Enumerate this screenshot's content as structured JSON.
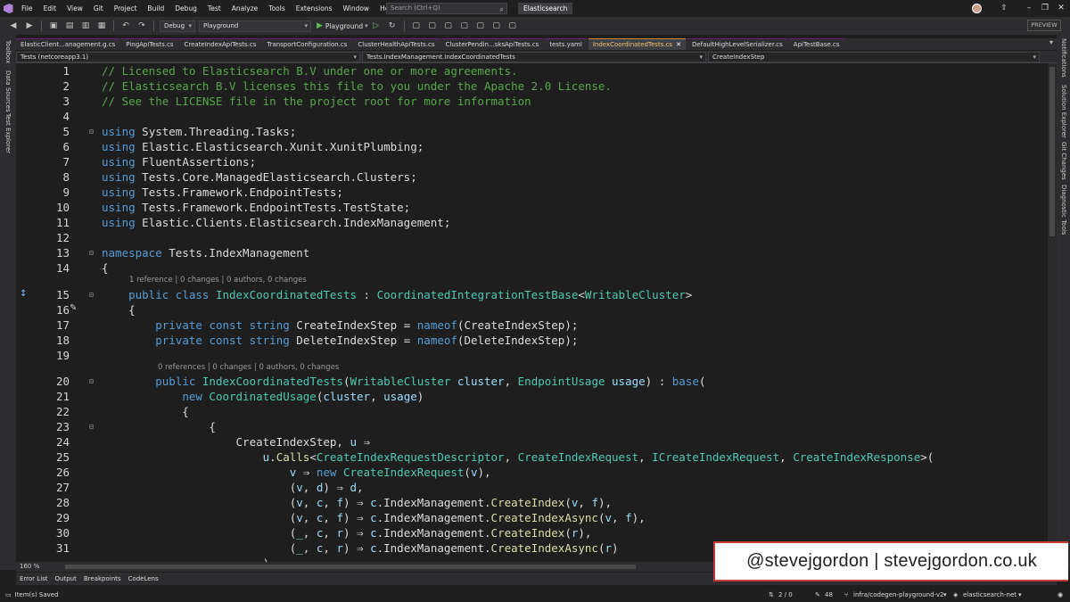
{
  "menu": {
    "items": [
      "File",
      "Edit",
      "View",
      "Git",
      "Project",
      "Build",
      "Debug",
      "Test",
      "Analyze",
      "Tools",
      "Extensions",
      "Window",
      "Help"
    ],
    "search_placeholder": "Search (Ctrl+Q)",
    "solution_name": "Elasticsearch"
  },
  "toolbar": {
    "config": "Debug",
    "project": "Playground",
    "run_target": "Playground",
    "preview_label": "PREVIEW"
  },
  "left_rail": [
    "Toolbox",
    "Data Sources",
    "Test Explorer"
  ],
  "right_rail": [
    "Notifications",
    "Solution Explorer",
    "Git Changes",
    "Diagnostic Tools"
  ],
  "tabs": [
    {
      "label": "ElasticClient...anagement.g.cs",
      "active": false
    },
    {
      "label": "PingApiTests.cs",
      "active": false
    },
    {
      "label": "CreateIndexApiTests.cs",
      "active": false
    },
    {
      "label": "TransportConfiguration.cs",
      "active": false
    },
    {
      "label": "ClusterHealthApiTests.cs",
      "active": false
    },
    {
      "label": "ClusterPendin...sksApiTests.cs",
      "active": false
    },
    {
      "label": "tests.yaml",
      "active": false
    },
    {
      "label": "IndexCoordinatedTests.cs",
      "active": true
    },
    {
      "label": "DefaultHighLevelSerializer.cs",
      "active": false
    },
    {
      "label": "ApiTestBase.cs",
      "active": false
    }
  ],
  "navbar": {
    "project": "Tests (netcoreapp3.1)",
    "type": "Tests.IndexManagement.IndexCoordinatedTests",
    "member": "CreateIndexStep"
  },
  "editor": {
    "codelens_class": "1 reference | 0 changes | 0 authors, 0 changes",
    "codelens_ctor": "0 references | 0 changes | 0 authors, 0 changes",
    "line_numbers": [
      "1",
      "2",
      "3",
      "4",
      "5",
      "6",
      "7",
      "8",
      "9",
      "10",
      "11",
      "12",
      "13",
      "14",
      "15",
      "16",
      "17",
      "18",
      "19",
      "20",
      "21",
      "22",
      "23",
      "24",
      "25",
      "26",
      "27",
      "28",
      "29",
      "30",
      "31"
    ]
  },
  "zoom": "160 %",
  "bottom_tabs": [
    "Error List",
    "Output",
    "Breakpoints",
    "CodeLens"
  ],
  "status": {
    "left": "Item(s) Saved",
    "position": "2 / 0",
    "changes": "48",
    "branch": "infra/codegen-playground-v2",
    "repo": "elasticsearch-net"
  },
  "watermark": "@stevejgordon | stevejgordon.co.uk"
}
